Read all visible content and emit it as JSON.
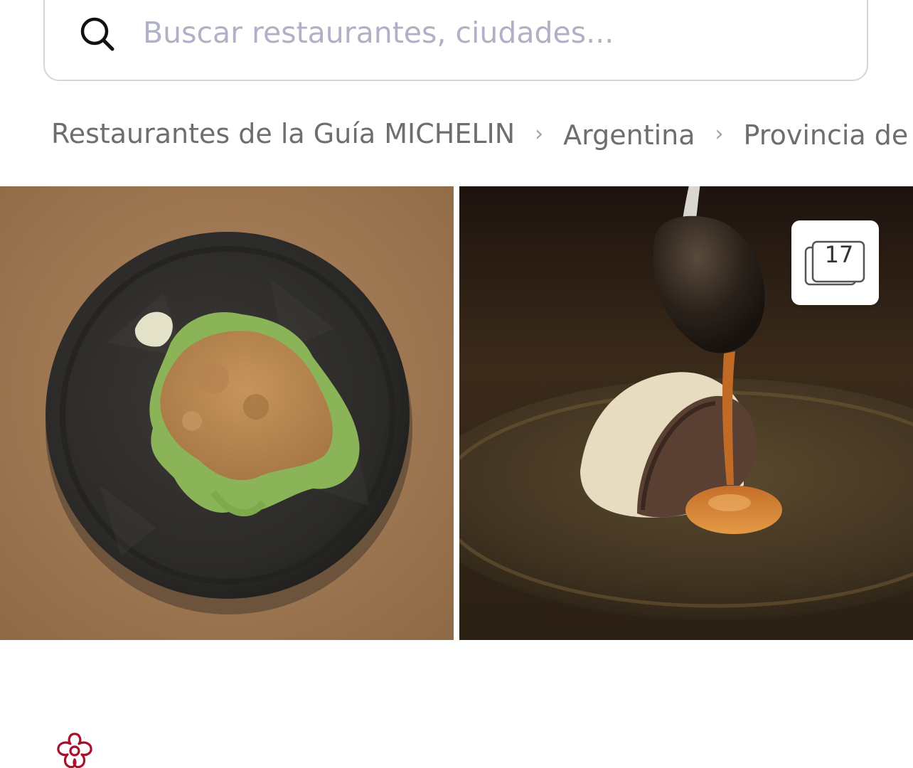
{
  "search": {
    "placeholder": "Buscar restaurantes, ciudades..."
  },
  "breadcrumb": {
    "items": [
      {
        "label": "Restaurantes de la Guía MICHELIN"
      },
      {
        "label": "Argentina"
      },
      {
        "label": "Provincia de"
      }
    ],
    "separator": "›"
  },
  "gallery": {
    "count": "17",
    "photos": [
      {
        "icon": "food-photo-salad"
      },
      {
        "icon": "food-photo-dessert"
      }
    ]
  },
  "rating": {
    "icon": "michelin-star-icon",
    "color": "#a8112c"
  },
  "colors": {
    "placeholder": "#b0b0c6",
    "border": "#d5d5db",
    "breadcrumb_text": "#6e6e6e"
  }
}
